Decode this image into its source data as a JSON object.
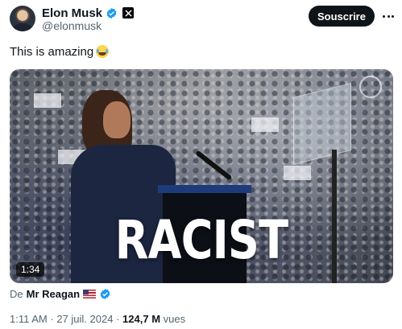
{
  "author": {
    "name": "Elon Musk",
    "handle": "@elonmusk"
  },
  "actions": {
    "follow_label": "Souscrire"
  },
  "post": {
    "text": "This is amazing"
  },
  "media": {
    "caption": "RACIST",
    "duration": "1:34"
  },
  "source": {
    "prefix": "De",
    "name": "Mr Reagan"
  },
  "meta": {
    "time": "1:11 AM",
    "separator": "·",
    "date": "27 juil. 2024",
    "views_count": "124,7 M",
    "views_label": "vues"
  },
  "icons": {
    "verified": "verified-badge-icon",
    "x_logo": "x-logo-icon",
    "emoji": "face-with-tears-of-joy-emoji",
    "flag": "us-flag-emoji"
  },
  "colors": {
    "verified_blue": "#1d9bf0",
    "primary_text": "#0f1419",
    "secondary_text": "#536471",
    "button_bg": "#0f1419"
  }
}
